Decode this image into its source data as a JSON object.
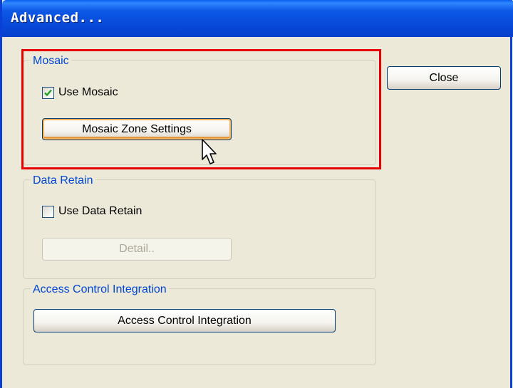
{
  "window": {
    "title": "Advanced..."
  },
  "mosaic": {
    "legend": "Mosaic",
    "use_checkbox_label": "Use Mosaic",
    "use_checked": true,
    "settings_button": "Mosaic Zone Settings"
  },
  "data_retain": {
    "legend": "Data Retain",
    "use_checkbox_label": "Use Data Retain",
    "use_checked": false,
    "detail_button": "Detail.."
  },
  "access_control": {
    "legend": "Access Control Integration",
    "button": "Access Control Integration"
  },
  "close_button": "Close",
  "colors": {
    "title_bar": "#0a4fe0",
    "dialog_bg": "#ece9d8",
    "legend_text": "#0046d5",
    "highlight": "#e80000"
  }
}
